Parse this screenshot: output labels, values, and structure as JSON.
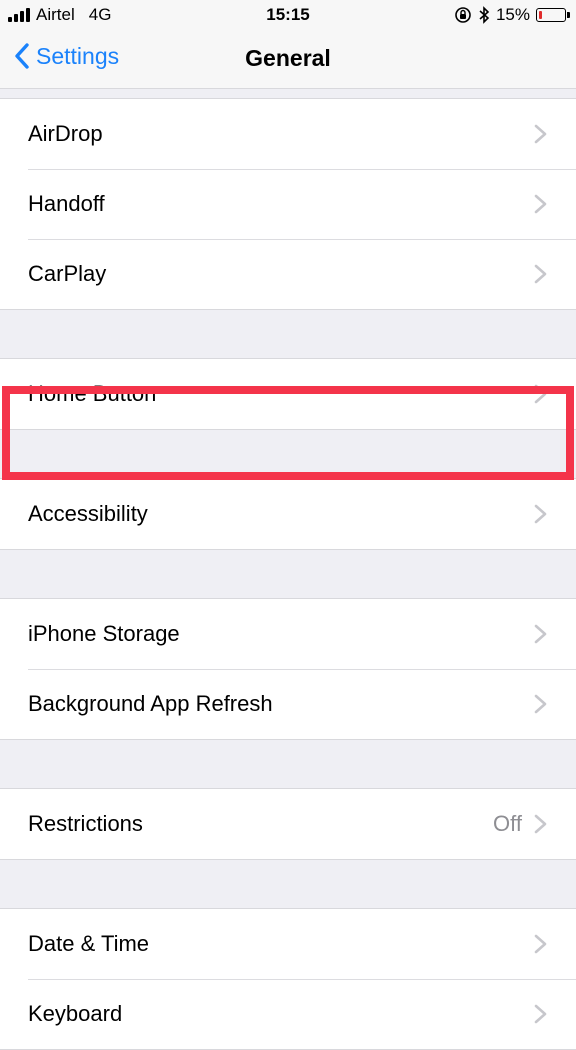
{
  "status_bar": {
    "carrier": "Airtel",
    "network": "4G",
    "time": "15:15",
    "battery_percent": "15%",
    "battery_level": 0.15
  },
  "nav": {
    "back_label": "Settings",
    "title": "General"
  },
  "sections": {
    "group1": [
      "AirDrop",
      "Handoff",
      "CarPlay"
    ],
    "group2": [
      "Home Button"
    ],
    "group3": [
      "Accessibility"
    ],
    "group4": [
      "iPhone Storage",
      "Background App Refresh"
    ],
    "group5": {
      "label": "Restrictions",
      "value": "Off"
    },
    "group6": [
      "Date & Time",
      "Keyboard"
    ]
  },
  "colors": {
    "accent": "#1a82fb",
    "highlight": "#f4344a",
    "battery_low": "#e02b2b"
  }
}
